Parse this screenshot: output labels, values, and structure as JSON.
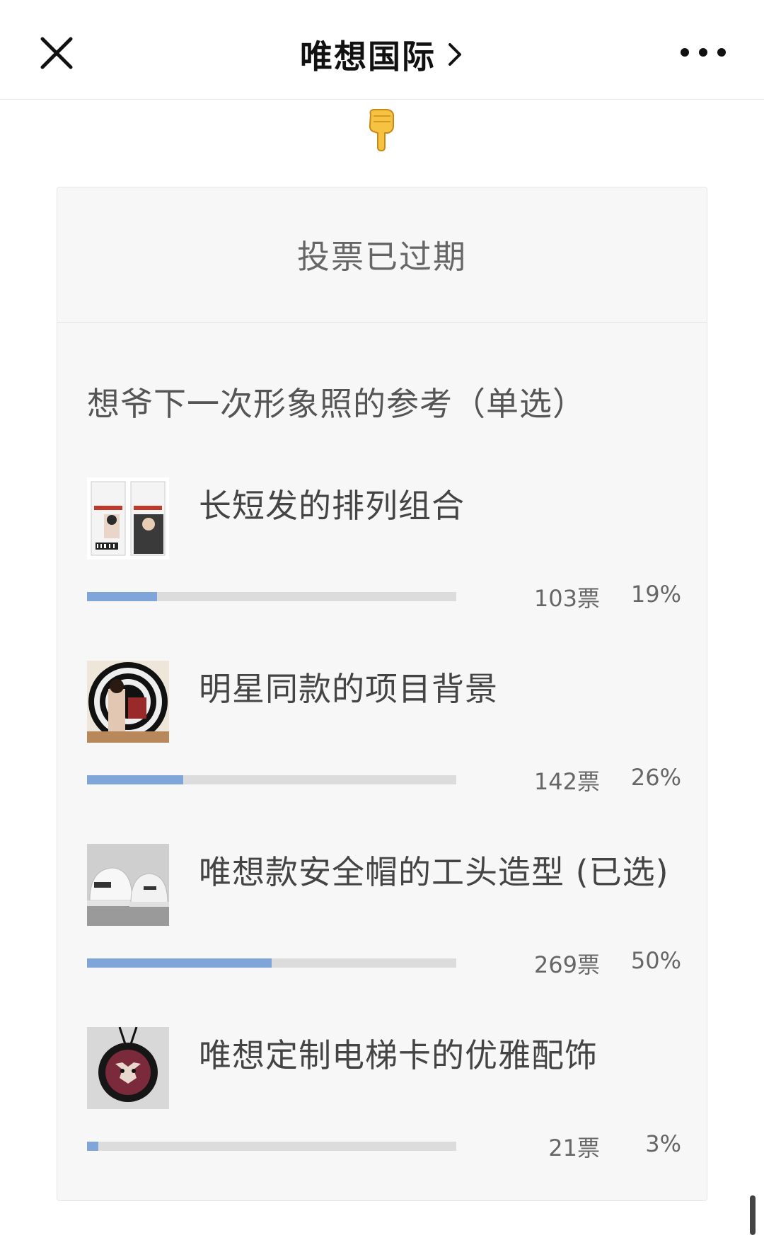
{
  "header": {
    "title": "唯想国际",
    "close_icon": "close-icon",
    "chevron_icon": "chevron-right-icon",
    "more_icon": "more-dots-icon"
  },
  "pointer_icon": "pointing-down-hand-icon",
  "poll": {
    "status": "投票已过期",
    "question": "想爷下一次形象照的参考（单选）",
    "bar_color": "#80a5d9",
    "track_color": "#dcdcdc",
    "options": [
      {
        "label": "长短发的排列组合",
        "votes": "103票",
        "percent": "19%",
        "fraction": 0.19,
        "thumb_icon": "id-card-photos-thumbnail"
      },
      {
        "label": "明星同款的项目背景",
        "votes": "142票",
        "percent": "26%",
        "fraction": 0.26,
        "thumb_icon": "spiral-backdrop-photo-thumbnail"
      },
      {
        "label": "唯想款安全帽的工头造型 (已选)",
        "votes": "269票",
        "percent": "50%",
        "fraction": 0.5,
        "thumb_icon": "hard-hats-thumbnail"
      },
      {
        "label": "唯想定制电梯卡的优雅配饰",
        "votes": "21票",
        "percent": "3%",
        "fraction": 0.03,
        "thumb_icon": "tiger-pendant-thumbnail"
      }
    ]
  }
}
